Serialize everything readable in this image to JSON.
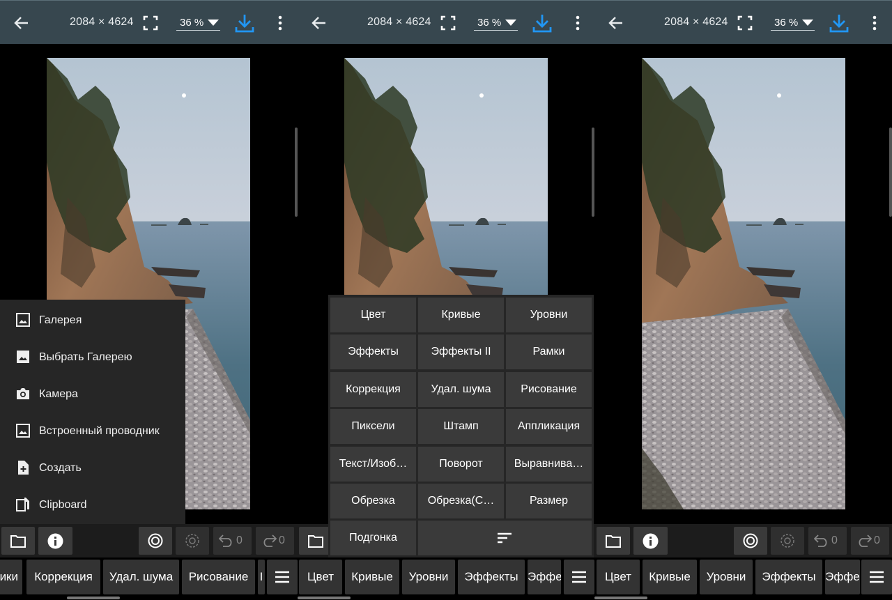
{
  "panels": [
    {
      "topbar": {
        "dimensions": "2084 × 4624",
        "zoom": "36 %"
      },
      "toolbar": {
        "undo_count": "0",
        "redo_count": "0"
      },
      "strip": [
        "ики",
        "Коррекция",
        "Удал. шума",
        "Рисование",
        "I"
      ]
    },
    {
      "topbar": {
        "dimensions": "2084 × 4624",
        "zoom": "36 %"
      },
      "toolbar": {
        "undo_count": "0",
        "redo_count": "0"
      },
      "strip": [
        "Цвет",
        "Кривые",
        "Уровни",
        "Эффекты",
        "Эффе"
      ]
    },
    {
      "topbar": {
        "dimensions": "2084 × 4624",
        "zoom": "36 %"
      },
      "toolbar": {
        "undo_count": "0",
        "redo_count": "0"
      },
      "strip": [
        "Цвет",
        "Кривые",
        "Уровни",
        "Эффекты",
        "Эффе"
      ]
    }
  ],
  "open_menu": {
    "items": [
      {
        "label": "Галерея",
        "icon": "image-icon"
      },
      {
        "label": "Выбрать Галерею",
        "icon": "image-filled-icon"
      },
      {
        "label": "Камера",
        "icon": "camera-icon"
      },
      {
        "label": "Встроенный проводник",
        "icon": "image-icon"
      },
      {
        "label": "Создать",
        "icon": "file-plus-icon"
      },
      {
        "label": "Clipboard",
        "icon": "clipboard-icon"
      }
    ]
  },
  "tools_grid": {
    "items": [
      "Цвет",
      "Кривые",
      "Уровни",
      "Эффекты",
      "Эффекты II",
      "Рамки",
      "Коррекция",
      "Удал. шума",
      "Рисование",
      "Пиксели",
      "Штамп",
      "Аппликация",
      "Текст/Изоб…",
      "Поворот",
      "Выравнива…",
      "Обрезка",
      "Обрезка(С…",
      "Размер",
      "Подгонка"
    ]
  },
  "colors": {
    "topbar": "#37474f",
    "accent": "#2196f3",
    "panel": "#262626",
    "button": "#3a3a3a"
  }
}
